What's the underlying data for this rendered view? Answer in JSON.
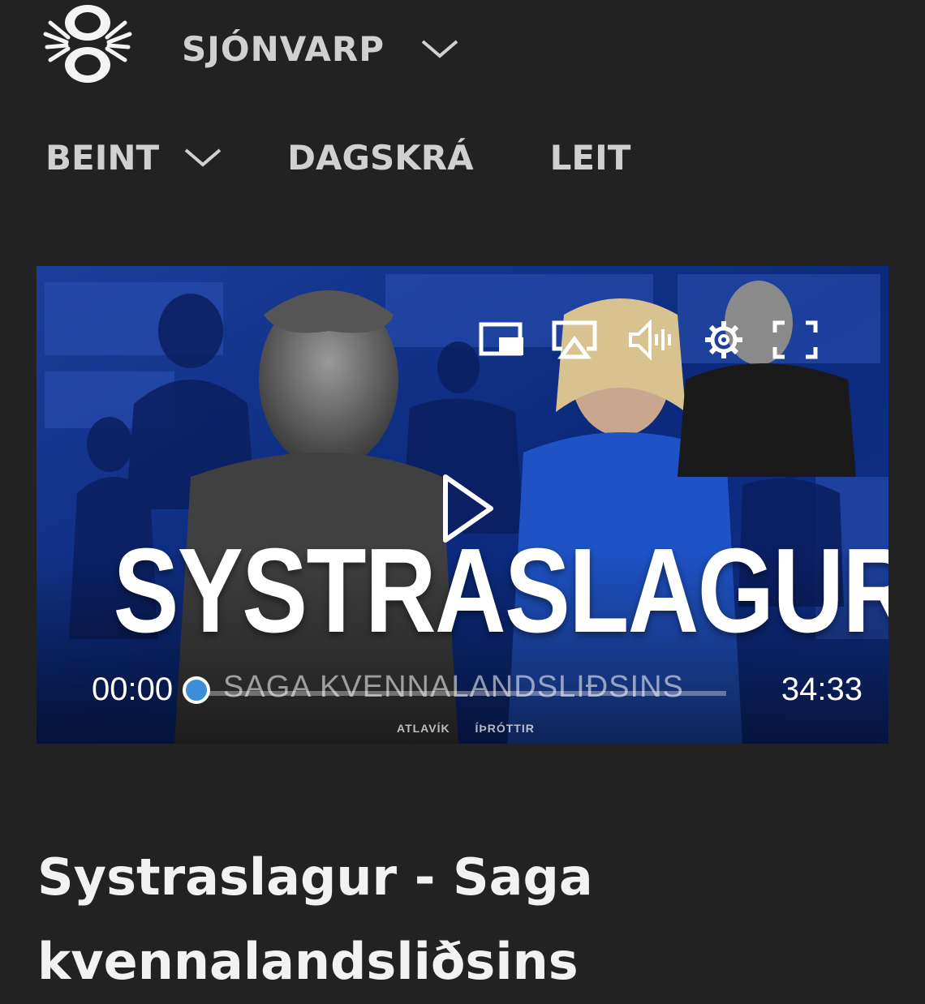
{
  "header": {
    "logo_icon": "ruv-logo-icon",
    "section_label": "SJÓNVARP",
    "section_chevron_icon": "chevron-down-icon"
  },
  "nav": {
    "items": [
      {
        "label": "BEINT",
        "has_dropdown": true
      },
      {
        "label": "DAGSKRÁ",
        "has_dropdown": false
      },
      {
        "label": "LEIT",
        "has_dropdown": false
      }
    ]
  },
  "player": {
    "poster_title": "SYSTRASLAGUR",
    "poster_subtitle": "SAGA KVENNALANDSLIÐSINS",
    "poster_logos": [
      "ATLAVÍK",
      "ÍÞRÓTTIR"
    ],
    "current_time": "00:00",
    "duration": "34:33",
    "progress": 0,
    "controls": [
      "picture-in-picture-icon",
      "airplay-icon",
      "volume-icon",
      "settings-gear-icon",
      "fullscreen-icon"
    ],
    "accent_color": "#3a8fd8"
  },
  "episode": {
    "title": "Systraslagur - Saga kvennalandsliðsins"
  }
}
